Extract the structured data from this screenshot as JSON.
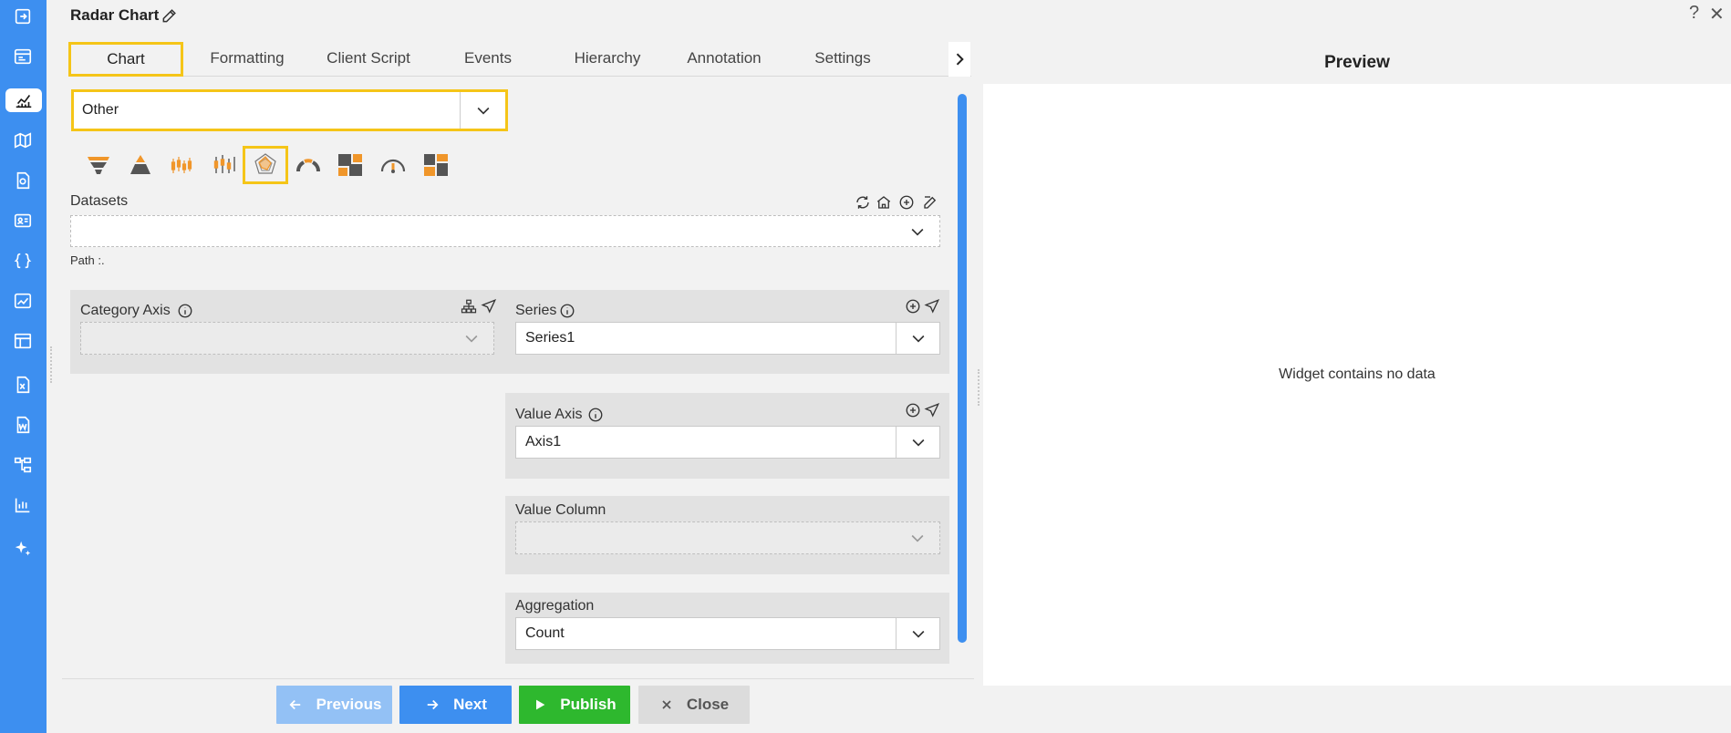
{
  "header": {
    "title": "Radar Chart",
    "help": "?",
    "close": "✕"
  },
  "tabs": [
    {
      "label": "Chart"
    },
    {
      "label": "Formatting"
    },
    {
      "label": "Client Script"
    },
    {
      "label": "Events"
    },
    {
      "label": "Hierarchy"
    },
    {
      "label": "Annotation"
    },
    {
      "label": "Settings"
    }
  ],
  "chart_category": {
    "value": "Other"
  },
  "datasets": {
    "label": "Datasets",
    "value": "",
    "path_label": "Path :."
  },
  "category_axis": {
    "label": "Category Axis",
    "value": ""
  },
  "series": {
    "label": "Series",
    "value": "Series1"
  },
  "value_axis": {
    "label": "Value Axis",
    "value": "Axis1"
  },
  "value_column": {
    "label": "Value Column",
    "value": ""
  },
  "aggregation": {
    "label": "Aggregation",
    "value": "Count"
  },
  "preview": {
    "title": "Preview",
    "empty_message": "Widget contains no data"
  },
  "footer": {
    "previous": "Previous",
    "next": "Next",
    "publish": "Publish",
    "close": "Close"
  },
  "colors": {
    "accent": "#3d8ff0",
    "highlight": "#f5c518",
    "publish": "#2eb82e",
    "orange_icon": "#f0962a"
  },
  "rail_icons": [
    "login-icon",
    "dashboard-icon",
    "chart-icon",
    "map-icon",
    "report-icon",
    "contact-card-icon",
    "code-braces-icon",
    "image-chart-icon",
    "table-icon",
    "excel-icon",
    "word-icon",
    "tree-icon",
    "bar-chart-icon",
    "ai-sparkle-icon"
  ]
}
